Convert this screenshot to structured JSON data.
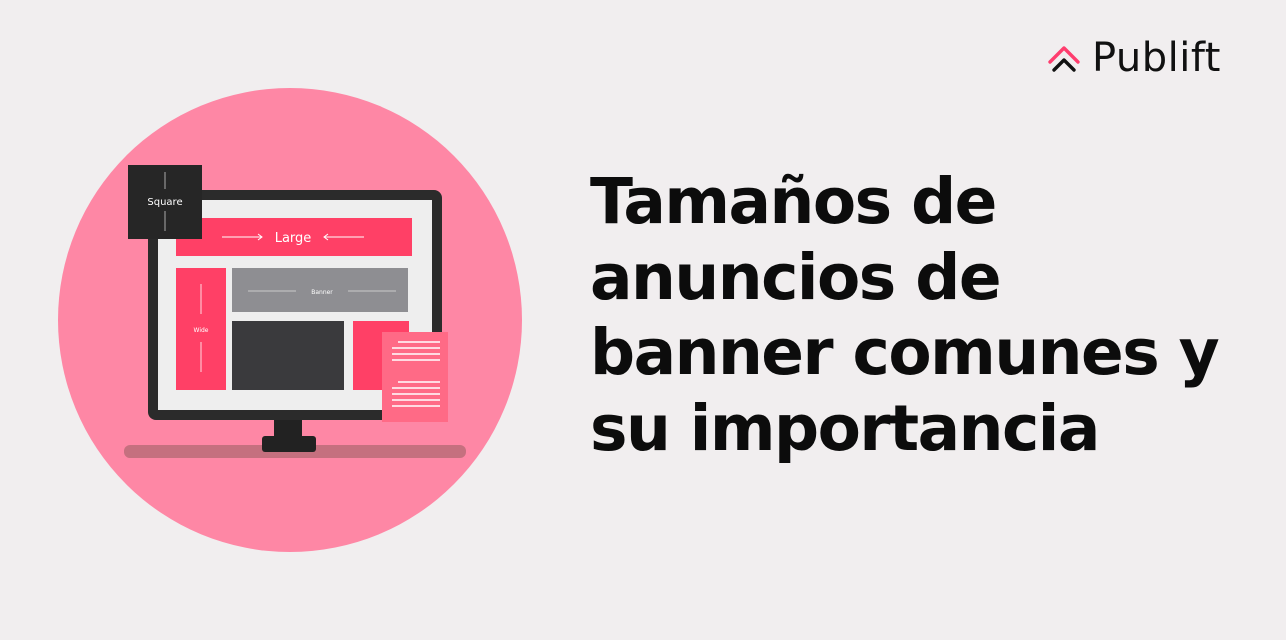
{
  "brand": {
    "name": "Publift",
    "icon": "double-chevron-up-icon",
    "accent_color": "#ff3366"
  },
  "headline": {
    "lines": [
      "Tamaños de",
      "anuncios de",
      "banner comunes y",
      "su importancia"
    ]
  },
  "illustration": {
    "circle_color": "#fe87a5",
    "ad_labels": {
      "square": "Square",
      "large": "Large",
      "banner": "Banner",
      "wide": "Wide"
    }
  }
}
